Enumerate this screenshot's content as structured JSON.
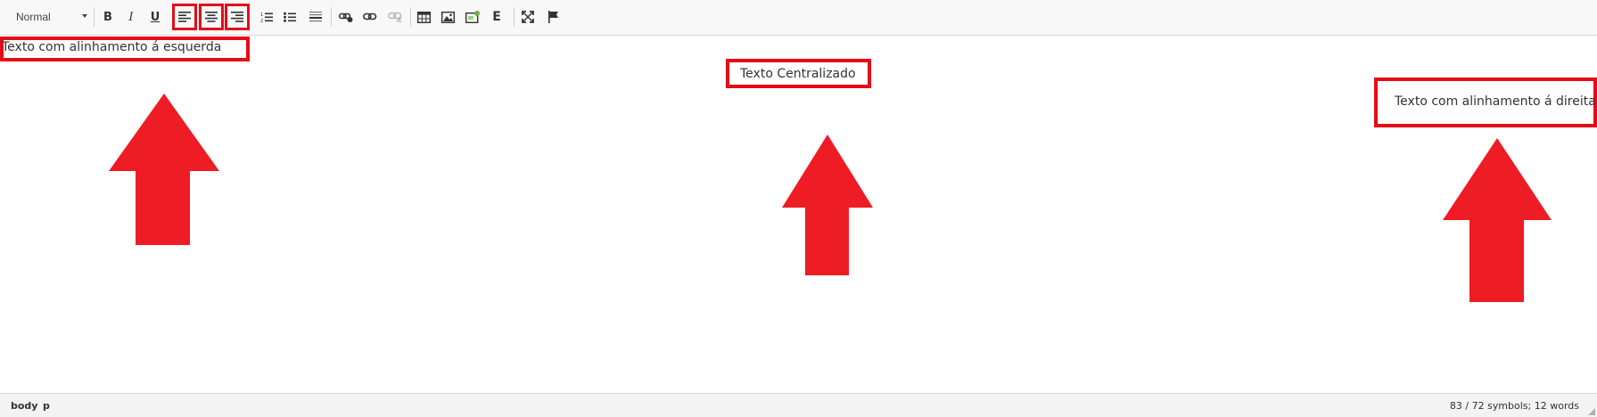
{
  "toolbar": {
    "format_value": "Normal",
    "bold_label": "B",
    "italic_label": "I",
    "underline_label": "U",
    "source_label": "E"
  },
  "editor": {
    "left_text": "Texto com alinhamento á esquerda",
    "center_text": "Texto Centralizado",
    "right_text": "Texto com alinhamento á direita"
  },
  "status": {
    "crumb_body": "body",
    "crumb_p": "p",
    "count": "83 / 72 symbols; 12 words"
  },
  "colors": {
    "annotation": "#e30d17",
    "toolbar_bg": "#f8f8f8"
  }
}
